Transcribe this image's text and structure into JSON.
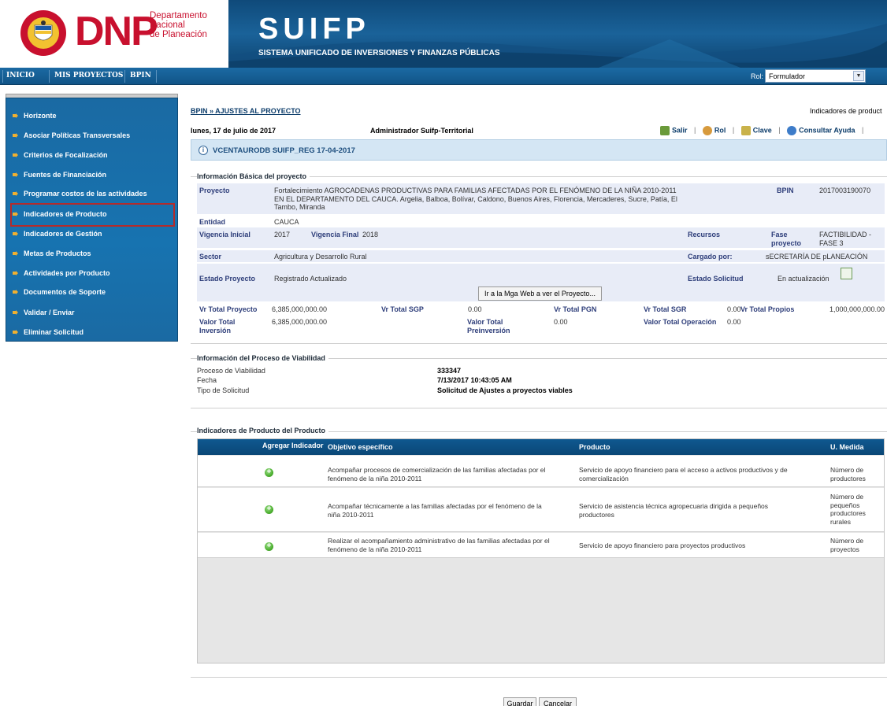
{
  "header": {
    "logo_text": "DNP",
    "org_lines": [
      "Departamento",
      "Nacional",
      "de Planeación"
    ],
    "seal_text": [
      "REPÚBLICA",
      "DE COLOMBIA"
    ],
    "app_title": "SUIFP",
    "app_subtitle": "SISTEMA UNIFICADO DE INVERSIONES Y FINANZAS PÚBLICAS"
  },
  "nav": {
    "items": [
      "INICIO",
      "MIS PROYECTOS",
      "BPIN"
    ],
    "rol_label": "Rol:",
    "rol_value": "Formulador"
  },
  "sidebar": {
    "items": [
      "Horizonte",
      "Asociar Políticas Transversales",
      "Criterios de Focalización",
      "Fuentes de Financiación",
      "Programar costos de las actividades",
      "Indicadores de Producto",
      "Indicadores de Gestión",
      "Metas de Productos",
      "Actividades por Producto",
      "Documentos de Soporte",
      "Validar / Enviar",
      "Eliminar Solicitud"
    ],
    "selected": "Indicadores de Producto"
  },
  "main": {
    "breadcrumb": "BPIN » AJUSTES AL PROYECTO",
    "breadcrumb_right": "Indicadores de product",
    "date": "lunes, 17 de julio de 2017",
    "user": "Administrador Suifp-Territorial",
    "links": {
      "salir": "Salir",
      "rol": "Rol",
      "clave": "Clave",
      "ayuda": "Consultar Ayuda"
    },
    "version": "VCENTAURODB SUIFP_REG 17-04-2017"
  },
  "basic_info": {
    "legend": "Información Básica del proyecto",
    "proyecto_label": "Proyecto",
    "proyecto_lines": [
      "Fortalecimiento AGROCADENAS PRODUCTIVAS PARA FAMILIAS AFECTADAS POR EL FENÓMENO DE LA NIÑA 2010-2011",
      "EN EL DEPARTAMENTO DEL CAUCA. Argelia, Balboa, Bolívar, Caldono, Buenos Aires, Florencia, Mercaderes, Sucre, Patía, El",
      "Tambo, Miranda"
    ],
    "bpin_label": "BPIN",
    "bpin": "2017003190070",
    "entidad_label": "Entidad",
    "entidad": "CAUCA",
    "vig_ini_label": "Vigencia Inicial",
    "vig_ini": "2017",
    "vig_fin_label": "Vigencia Final",
    "vig_fin": "2018",
    "recursos_label": "Recursos",
    "fase_label": [
      "Fase",
      "proyecto"
    ],
    "fase": [
      "FACTIBILIDAD -",
      "FASE 3"
    ],
    "sector_label": "Sector",
    "sector": "Agricultura y Desarrollo Rural",
    "cargado_label": "Cargado por:",
    "cargado": "sECRETARÍA DE pLANEACIÓN",
    "estado_label": "Estado Proyecto",
    "estado": "Registrado Actualizado",
    "estado_sol_label": "Estado Solicitud",
    "estado_sol": "En actualización",
    "mga_button": "Ir a la Mga Web a ver el Proyecto...",
    "vr_total_label": "Vr Total Proyecto",
    "vr_total": "6,385,000,000.00",
    "vr_sgp_label": "Vr Total SGP",
    "vr_sgp": "0.00",
    "vr_pgn_label": "Vr Total PGN",
    "vr_sgr_label": "Vr Total SGR",
    "vr_sgr": "0.00",
    "vr_propios_label": "Vr Total Propios",
    "vr_propios": "1,000,000,000.00",
    "inv_label": [
      "Valor Total",
      "Inversión"
    ],
    "inv": "6,385,000,000.00",
    "preinv_label": [
      "Valor Total",
      "Preinversión"
    ],
    "preinv": "0.00",
    "oper_label": "Valor Total Operación",
    "oper": "0.00"
  },
  "viability": {
    "legend": "Información del Proceso de Viabilidad",
    "proceso_label": "Proceso de Viabilidad",
    "proceso": "333347",
    "fecha_label": "Fecha",
    "fecha": "7/13/2017 10:43:05 AM",
    "tipo_label": "Tipo de Solicitud",
    "tipo": "Solicitud de Ajustes a proyectos viables"
  },
  "indicators": {
    "legend": "Indicadores de Producto del Producto",
    "headers": [
      "Agregar Indicador",
      "Objetivo específico",
      "Producto",
      "U. Medida"
    ],
    "rows": [
      {
        "objetivo": [
          "Acompañar procesos de comercialización de las familias afectadas por el",
          "fenómeno de la niña 2010-2011"
        ],
        "producto": [
          "Servicio de apoyo financiero para el acceso a activos productivos y de",
          "comercialización"
        ],
        "medida": [
          "Número de",
          "productores"
        ]
      },
      {
        "objetivo": [
          "Acompañar técnicamente a las familias afectadas por el fenómeno de la",
          "niña 2010-2011"
        ],
        "producto": [
          "Servicio de asistencia técnica agropecuaria dirigida a pequeños",
          "productores"
        ],
        "medida": [
          "Número de",
          "pequeños",
          "productores",
          "rurales"
        ]
      },
      {
        "objetivo": [
          "Realizar el acompañamiento administrativo de las familias afectadas por el",
          "fenómeno de la niña 2010-2011"
        ],
        "producto": [
          "Servicio de apoyo financiero para proyectos productivos"
        ],
        "medida": [
          "Número de",
          "proyectos"
        ]
      }
    ]
  },
  "footer": {
    "guardar": "Guardar",
    "cancelar": "Cancelar"
  },
  "colors": {
    "brand_red": "#c8102e",
    "nav_blue": "#115487",
    "sidebar_blue": "#1773b0",
    "highlight": "#b42b2b"
  }
}
